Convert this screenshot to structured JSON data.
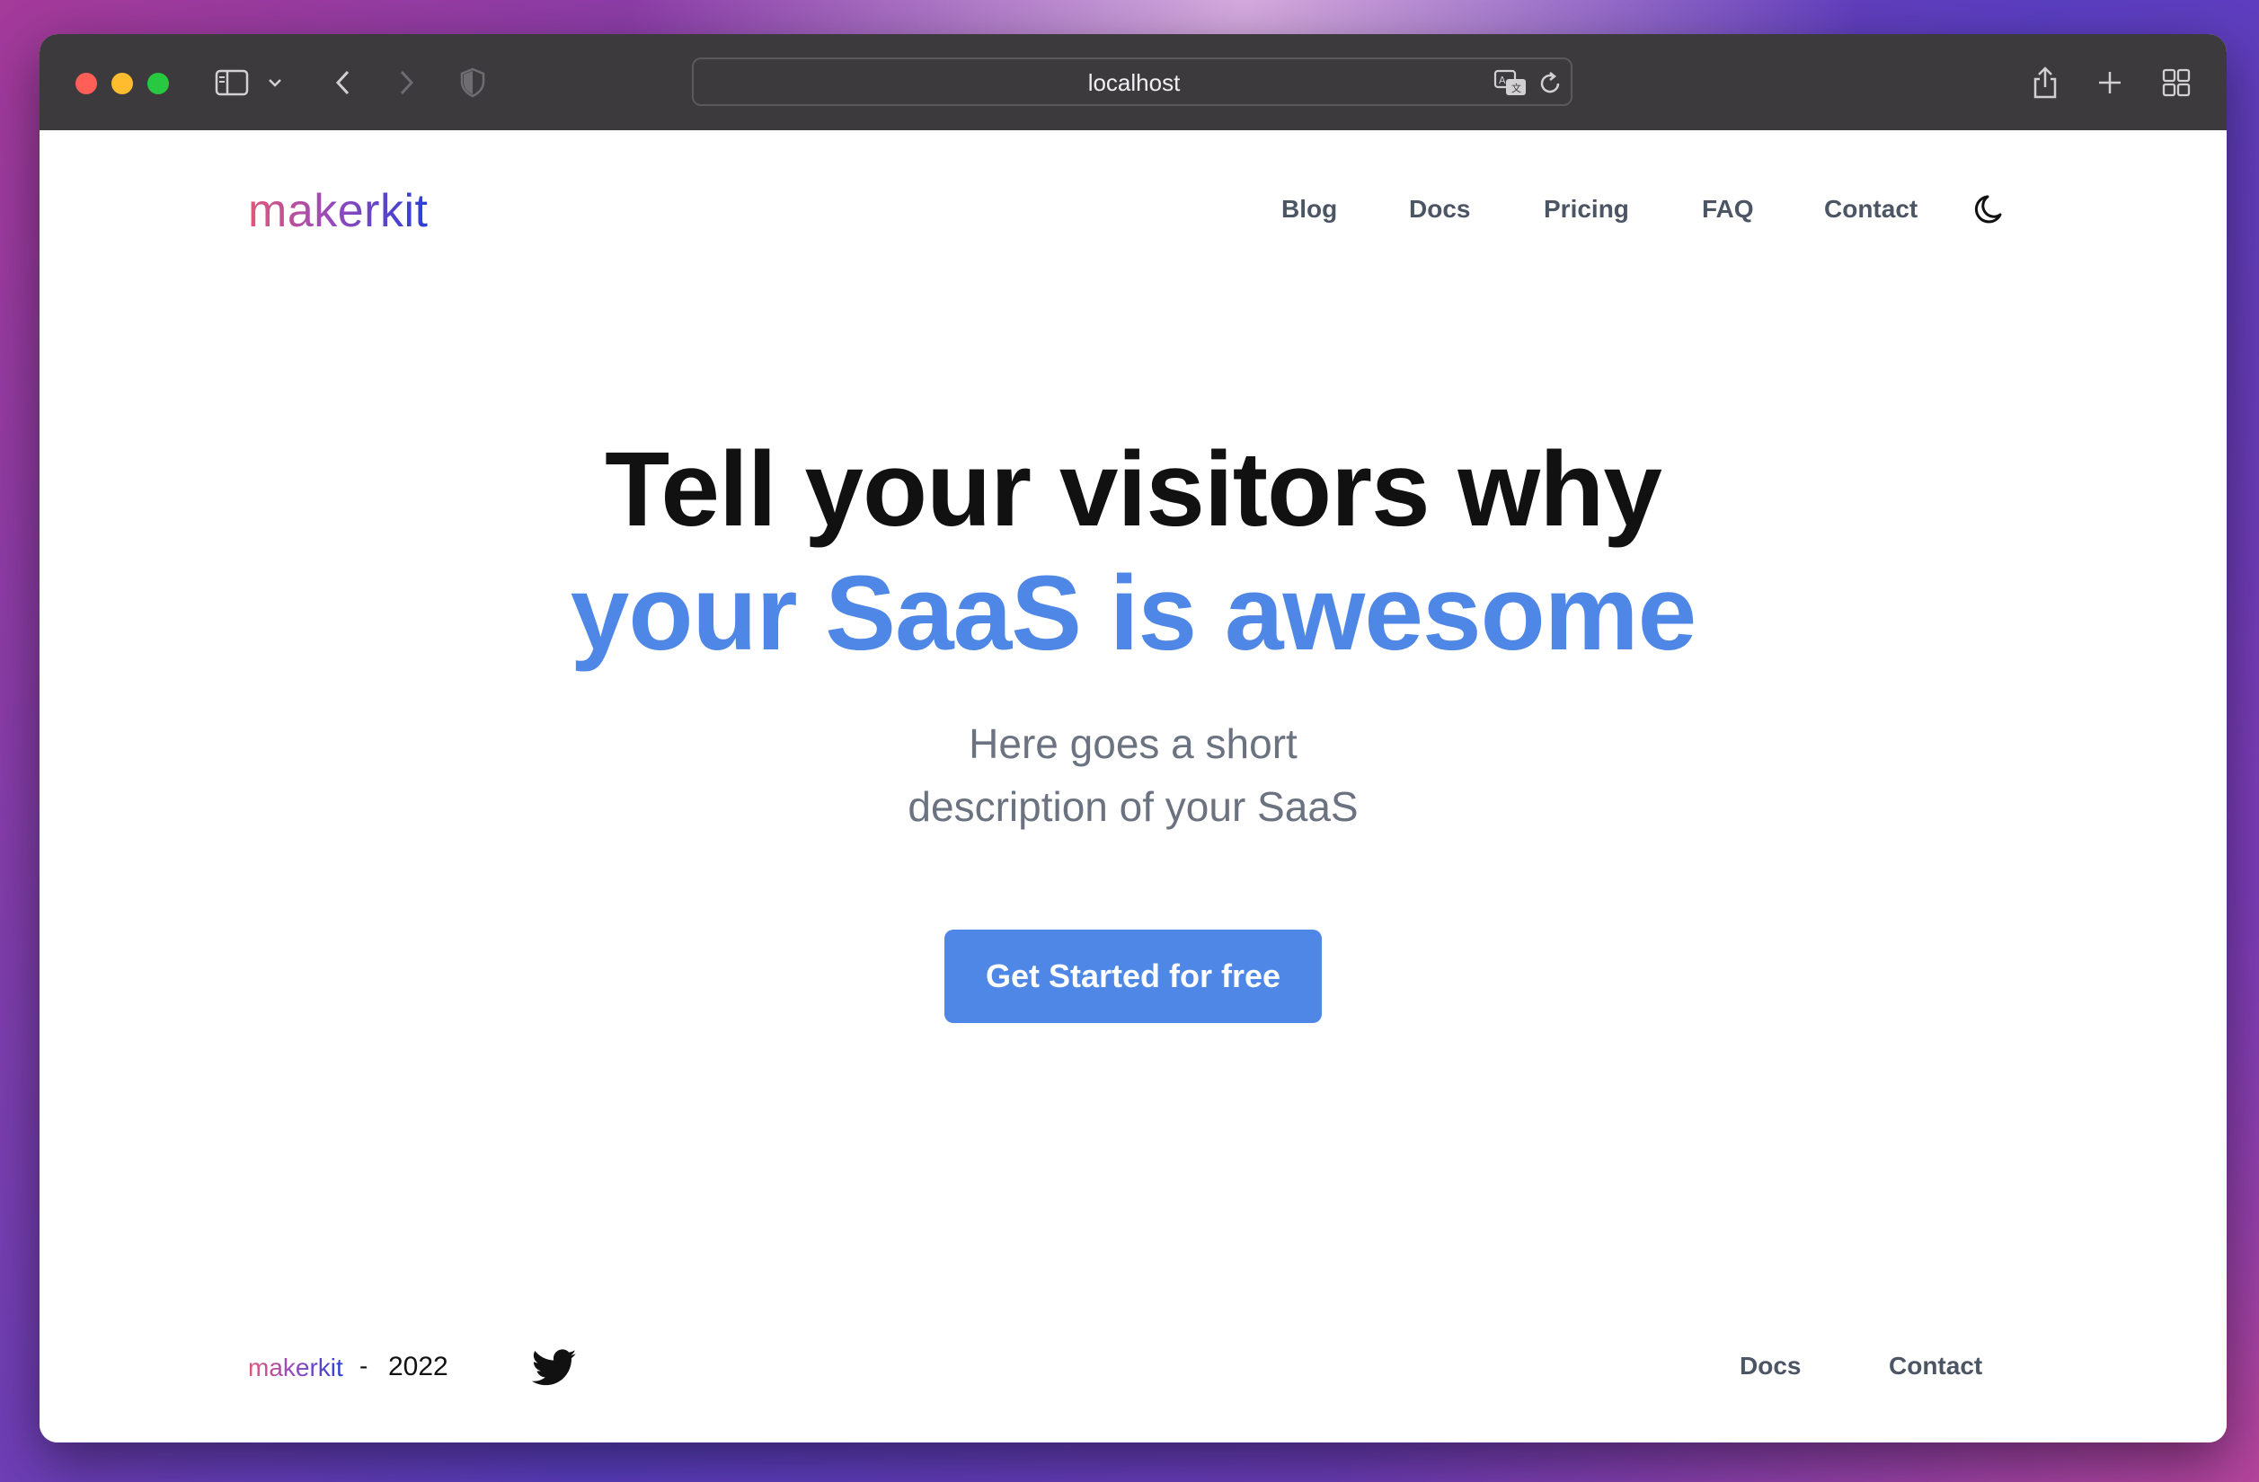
{
  "browser": {
    "url": "localhost"
  },
  "header": {
    "logo": "makerkit",
    "nav": [
      "Blog",
      "Docs",
      "Pricing",
      "FAQ",
      "Contact"
    ],
    "theme_toggle_icon": "moon-icon"
  },
  "hero": {
    "line1": "Tell your visitors why",
    "line2": "your SaaS is awesome",
    "description_line1": "Here goes a short",
    "description_line2": "description of your SaaS",
    "cta_label": "Get Started for free",
    "accent_color": "#4f87e6"
  },
  "footer": {
    "logo": "makerkit",
    "separator": "-",
    "year": "2022",
    "social_icon": "twitter-icon",
    "links": [
      "Docs",
      "Contact"
    ]
  }
}
